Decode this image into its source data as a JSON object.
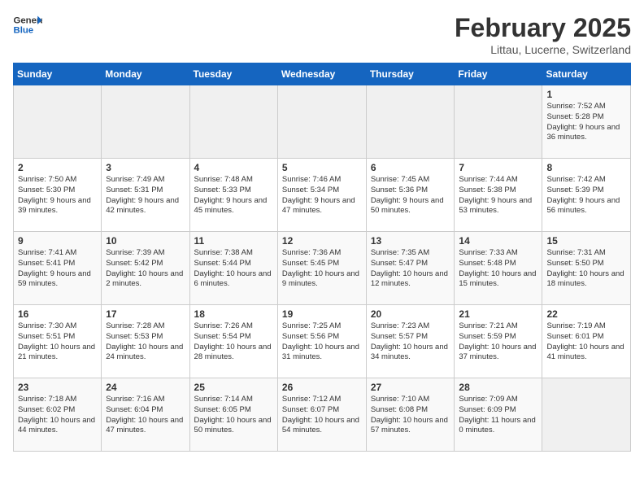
{
  "header": {
    "logo_line1": "General",
    "logo_line2": "Blue",
    "month": "February 2025",
    "location": "Littau, Lucerne, Switzerland"
  },
  "weekdays": [
    "Sunday",
    "Monday",
    "Tuesday",
    "Wednesday",
    "Thursday",
    "Friday",
    "Saturday"
  ],
  "weeks": [
    [
      {
        "day": "",
        "info": ""
      },
      {
        "day": "",
        "info": ""
      },
      {
        "day": "",
        "info": ""
      },
      {
        "day": "",
        "info": ""
      },
      {
        "day": "",
        "info": ""
      },
      {
        "day": "",
        "info": ""
      },
      {
        "day": "1",
        "info": "Sunrise: 7:52 AM\nSunset: 5:28 PM\nDaylight: 9 hours and 36 minutes."
      }
    ],
    [
      {
        "day": "2",
        "info": "Sunrise: 7:50 AM\nSunset: 5:30 PM\nDaylight: 9 hours and 39 minutes."
      },
      {
        "day": "3",
        "info": "Sunrise: 7:49 AM\nSunset: 5:31 PM\nDaylight: 9 hours and 42 minutes."
      },
      {
        "day": "4",
        "info": "Sunrise: 7:48 AM\nSunset: 5:33 PM\nDaylight: 9 hours and 45 minutes."
      },
      {
        "day": "5",
        "info": "Sunrise: 7:46 AM\nSunset: 5:34 PM\nDaylight: 9 hours and 47 minutes."
      },
      {
        "day": "6",
        "info": "Sunrise: 7:45 AM\nSunset: 5:36 PM\nDaylight: 9 hours and 50 minutes."
      },
      {
        "day": "7",
        "info": "Sunrise: 7:44 AM\nSunset: 5:38 PM\nDaylight: 9 hours and 53 minutes."
      },
      {
        "day": "8",
        "info": "Sunrise: 7:42 AM\nSunset: 5:39 PM\nDaylight: 9 hours and 56 minutes."
      }
    ],
    [
      {
        "day": "9",
        "info": "Sunrise: 7:41 AM\nSunset: 5:41 PM\nDaylight: 9 hours and 59 minutes."
      },
      {
        "day": "10",
        "info": "Sunrise: 7:39 AM\nSunset: 5:42 PM\nDaylight: 10 hours and 2 minutes."
      },
      {
        "day": "11",
        "info": "Sunrise: 7:38 AM\nSunset: 5:44 PM\nDaylight: 10 hours and 6 minutes."
      },
      {
        "day": "12",
        "info": "Sunrise: 7:36 AM\nSunset: 5:45 PM\nDaylight: 10 hours and 9 minutes."
      },
      {
        "day": "13",
        "info": "Sunrise: 7:35 AM\nSunset: 5:47 PM\nDaylight: 10 hours and 12 minutes."
      },
      {
        "day": "14",
        "info": "Sunrise: 7:33 AM\nSunset: 5:48 PM\nDaylight: 10 hours and 15 minutes."
      },
      {
        "day": "15",
        "info": "Sunrise: 7:31 AM\nSunset: 5:50 PM\nDaylight: 10 hours and 18 minutes."
      }
    ],
    [
      {
        "day": "16",
        "info": "Sunrise: 7:30 AM\nSunset: 5:51 PM\nDaylight: 10 hours and 21 minutes."
      },
      {
        "day": "17",
        "info": "Sunrise: 7:28 AM\nSunset: 5:53 PM\nDaylight: 10 hours and 24 minutes."
      },
      {
        "day": "18",
        "info": "Sunrise: 7:26 AM\nSunset: 5:54 PM\nDaylight: 10 hours and 28 minutes."
      },
      {
        "day": "19",
        "info": "Sunrise: 7:25 AM\nSunset: 5:56 PM\nDaylight: 10 hours and 31 minutes."
      },
      {
        "day": "20",
        "info": "Sunrise: 7:23 AM\nSunset: 5:57 PM\nDaylight: 10 hours and 34 minutes."
      },
      {
        "day": "21",
        "info": "Sunrise: 7:21 AM\nSunset: 5:59 PM\nDaylight: 10 hours and 37 minutes."
      },
      {
        "day": "22",
        "info": "Sunrise: 7:19 AM\nSunset: 6:01 PM\nDaylight: 10 hours and 41 minutes."
      }
    ],
    [
      {
        "day": "23",
        "info": "Sunrise: 7:18 AM\nSunset: 6:02 PM\nDaylight: 10 hours and 44 minutes."
      },
      {
        "day": "24",
        "info": "Sunrise: 7:16 AM\nSunset: 6:04 PM\nDaylight: 10 hours and 47 minutes."
      },
      {
        "day": "25",
        "info": "Sunrise: 7:14 AM\nSunset: 6:05 PM\nDaylight: 10 hours and 50 minutes."
      },
      {
        "day": "26",
        "info": "Sunrise: 7:12 AM\nSunset: 6:07 PM\nDaylight: 10 hours and 54 minutes."
      },
      {
        "day": "27",
        "info": "Sunrise: 7:10 AM\nSunset: 6:08 PM\nDaylight: 10 hours and 57 minutes."
      },
      {
        "day": "28",
        "info": "Sunrise: 7:09 AM\nSunset: 6:09 PM\nDaylight: 11 hours and 0 minutes."
      },
      {
        "day": "",
        "info": ""
      }
    ]
  ]
}
